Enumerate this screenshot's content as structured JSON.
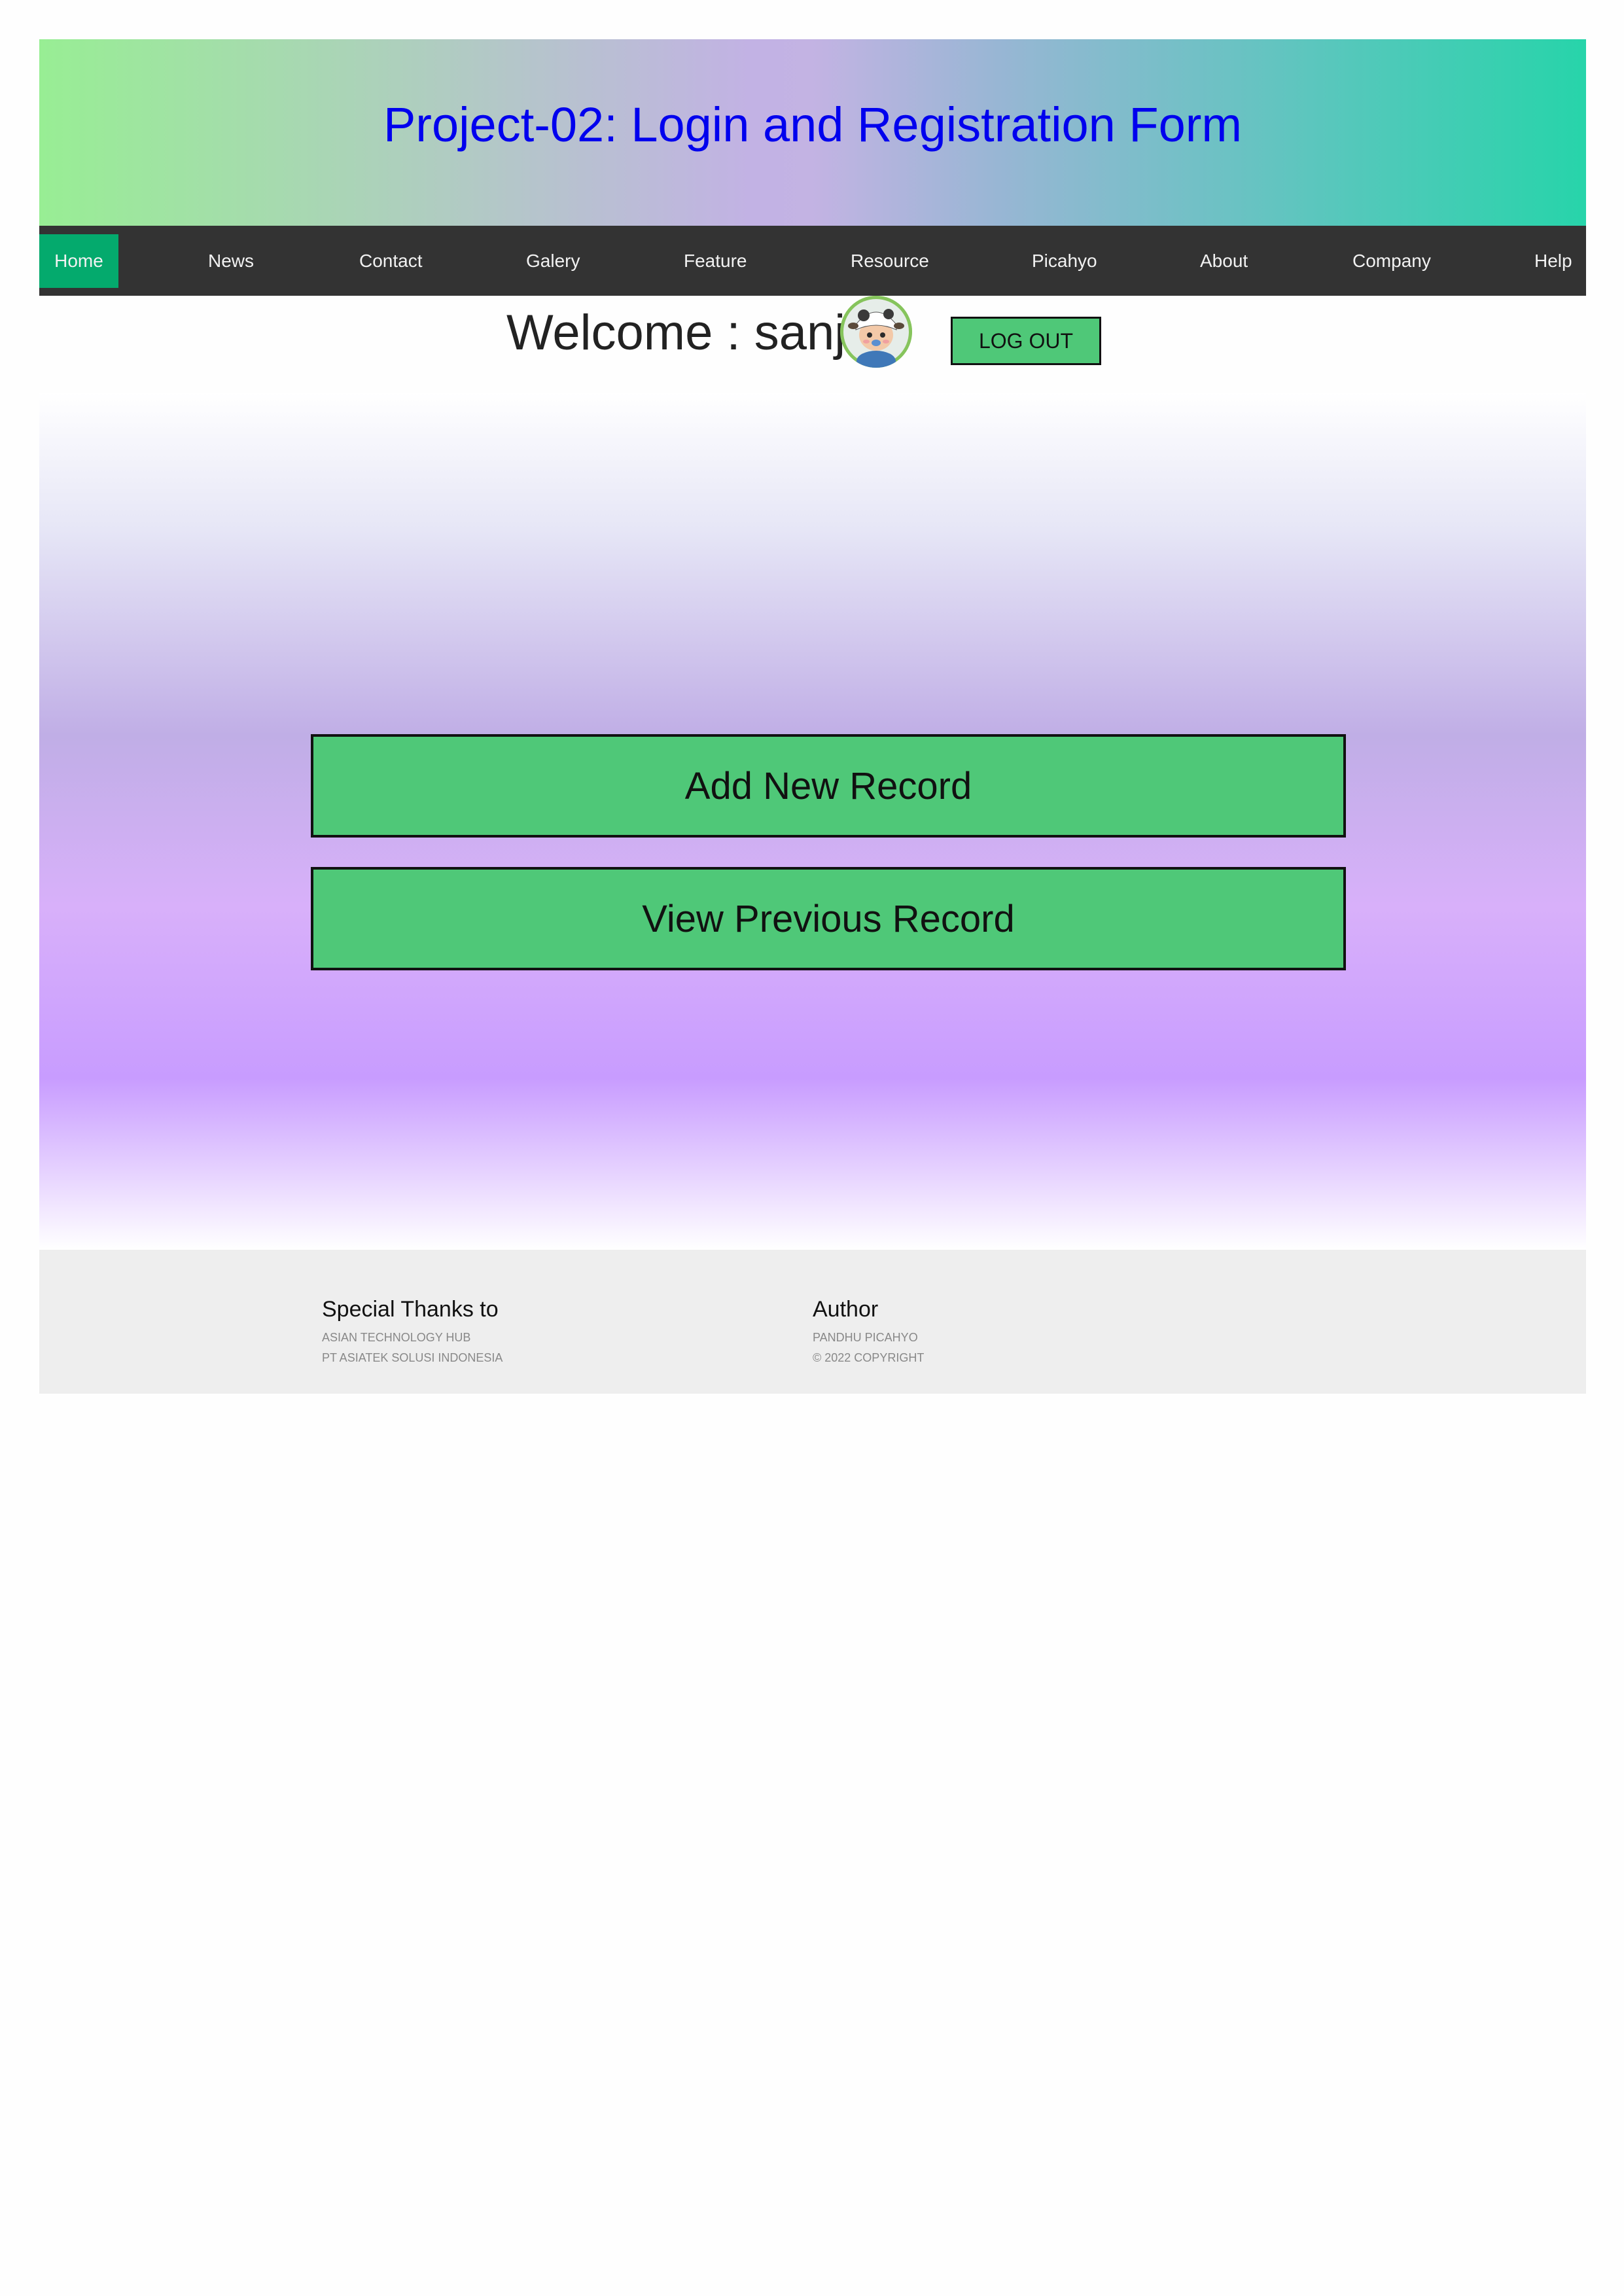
{
  "header": {
    "title": "Project-02: Login and Registration Form"
  },
  "nav": {
    "items": [
      {
        "label": "Home",
        "active": true
      },
      {
        "label": "News"
      },
      {
        "label": "Contact"
      },
      {
        "label": "Galery"
      },
      {
        "label": "Feature"
      },
      {
        "label": "Resource"
      },
      {
        "label": "Picahyo"
      },
      {
        "label": "About"
      },
      {
        "label": "Company"
      },
      {
        "label": "Help"
      }
    ]
  },
  "welcome": {
    "text": "Welcome : sanji",
    "logout_label": "LOG OUT"
  },
  "actions": {
    "add_label": "Add New Record",
    "view_label": "View Previous Record"
  },
  "footer": {
    "thanks_title": "Special Thanks to",
    "thanks_lines": [
      "ASIAN TECHNOLOGY HUB",
      "PT ASIATEK SOLUSI INDONESIA"
    ],
    "author_title": "Author",
    "author_lines": [
      "PANDHU PICAHYO",
      "© 2022 COPYRIGHT"
    ]
  },
  "colors": {
    "title": "#0000ee",
    "nav_bg": "#333333",
    "nav_active": "#04aa6d",
    "button_green": "#4fc878",
    "footer_bg": "#eeeeee"
  }
}
